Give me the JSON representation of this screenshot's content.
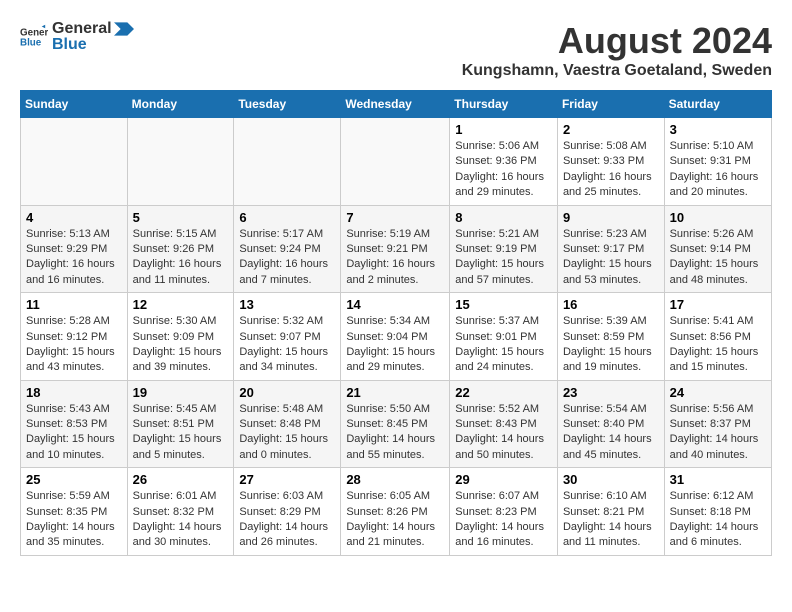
{
  "logo": {
    "line1": "General",
    "line2": "Blue"
  },
  "title": "August 2024",
  "subtitle": "Kungshamn, Vaestra Goetaland, Sweden",
  "weekdays": [
    "Sunday",
    "Monday",
    "Tuesday",
    "Wednesday",
    "Thursday",
    "Friday",
    "Saturday"
  ],
  "weeks": [
    [
      {
        "day": "",
        "content": ""
      },
      {
        "day": "",
        "content": ""
      },
      {
        "day": "",
        "content": ""
      },
      {
        "day": "",
        "content": ""
      },
      {
        "day": "1",
        "content": "Sunrise: 5:06 AM\nSunset: 9:36 PM\nDaylight: 16 hours\nand 29 minutes."
      },
      {
        "day": "2",
        "content": "Sunrise: 5:08 AM\nSunset: 9:33 PM\nDaylight: 16 hours\nand 25 minutes."
      },
      {
        "day": "3",
        "content": "Sunrise: 5:10 AM\nSunset: 9:31 PM\nDaylight: 16 hours\nand 20 minutes."
      }
    ],
    [
      {
        "day": "4",
        "content": "Sunrise: 5:13 AM\nSunset: 9:29 PM\nDaylight: 16 hours\nand 16 minutes."
      },
      {
        "day": "5",
        "content": "Sunrise: 5:15 AM\nSunset: 9:26 PM\nDaylight: 16 hours\nand 11 minutes."
      },
      {
        "day": "6",
        "content": "Sunrise: 5:17 AM\nSunset: 9:24 PM\nDaylight: 16 hours\nand 7 minutes."
      },
      {
        "day": "7",
        "content": "Sunrise: 5:19 AM\nSunset: 9:21 PM\nDaylight: 16 hours\nand 2 minutes."
      },
      {
        "day": "8",
        "content": "Sunrise: 5:21 AM\nSunset: 9:19 PM\nDaylight: 15 hours\nand 57 minutes."
      },
      {
        "day": "9",
        "content": "Sunrise: 5:23 AM\nSunset: 9:17 PM\nDaylight: 15 hours\nand 53 minutes."
      },
      {
        "day": "10",
        "content": "Sunrise: 5:26 AM\nSunset: 9:14 PM\nDaylight: 15 hours\nand 48 minutes."
      }
    ],
    [
      {
        "day": "11",
        "content": "Sunrise: 5:28 AM\nSunset: 9:12 PM\nDaylight: 15 hours\nand 43 minutes."
      },
      {
        "day": "12",
        "content": "Sunrise: 5:30 AM\nSunset: 9:09 PM\nDaylight: 15 hours\nand 39 minutes."
      },
      {
        "day": "13",
        "content": "Sunrise: 5:32 AM\nSunset: 9:07 PM\nDaylight: 15 hours\nand 34 minutes."
      },
      {
        "day": "14",
        "content": "Sunrise: 5:34 AM\nSunset: 9:04 PM\nDaylight: 15 hours\nand 29 minutes."
      },
      {
        "day": "15",
        "content": "Sunrise: 5:37 AM\nSunset: 9:01 PM\nDaylight: 15 hours\nand 24 minutes."
      },
      {
        "day": "16",
        "content": "Sunrise: 5:39 AM\nSunset: 8:59 PM\nDaylight: 15 hours\nand 19 minutes."
      },
      {
        "day": "17",
        "content": "Sunrise: 5:41 AM\nSunset: 8:56 PM\nDaylight: 15 hours\nand 15 minutes."
      }
    ],
    [
      {
        "day": "18",
        "content": "Sunrise: 5:43 AM\nSunset: 8:53 PM\nDaylight: 15 hours\nand 10 minutes."
      },
      {
        "day": "19",
        "content": "Sunrise: 5:45 AM\nSunset: 8:51 PM\nDaylight: 15 hours\nand 5 minutes."
      },
      {
        "day": "20",
        "content": "Sunrise: 5:48 AM\nSunset: 8:48 PM\nDaylight: 15 hours\nand 0 minutes."
      },
      {
        "day": "21",
        "content": "Sunrise: 5:50 AM\nSunset: 8:45 PM\nDaylight: 14 hours\nand 55 minutes."
      },
      {
        "day": "22",
        "content": "Sunrise: 5:52 AM\nSunset: 8:43 PM\nDaylight: 14 hours\nand 50 minutes."
      },
      {
        "day": "23",
        "content": "Sunrise: 5:54 AM\nSunset: 8:40 PM\nDaylight: 14 hours\nand 45 minutes."
      },
      {
        "day": "24",
        "content": "Sunrise: 5:56 AM\nSunset: 8:37 PM\nDaylight: 14 hours\nand 40 minutes."
      }
    ],
    [
      {
        "day": "25",
        "content": "Sunrise: 5:59 AM\nSunset: 8:35 PM\nDaylight: 14 hours\nand 35 minutes."
      },
      {
        "day": "26",
        "content": "Sunrise: 6:01 AM\nSunset: 8:32 PM\nDaylight: 14 hours\nand 30 minutes."
      },
      {
        "day": "27",
        "content": "Sunrise: 6:03 AM\nSunset: 8:29 PM\nDaylight: 14 hours\nand 26 minutes."
      },
      {
        "day": "28",
        "content": "Sunrise: 6:05 AM\nSunset: 8:26 PM\nDaylight: 14 hours\nand 21 minutes."
      },
      {
        "day": "29",
        "content": "Sunrise: 6:07 AM\nSunset: 8:23 PM\nDaylight: 14 hours\nand 16 minutes."
      },
      {
        "day": "30",
        "content": "Sunrise: 6:10 AM\nSunset: 8:21 PM\nDaylight: 14 hours\nand 11 minutes."
      },
      {
        "day": "31",
        "content": "Sunrise: 6:12 AM\nSunset: 8:18 PM\nDaylight: 14 hours\nand 6 minutes."
      }
    ]
  ]
}
